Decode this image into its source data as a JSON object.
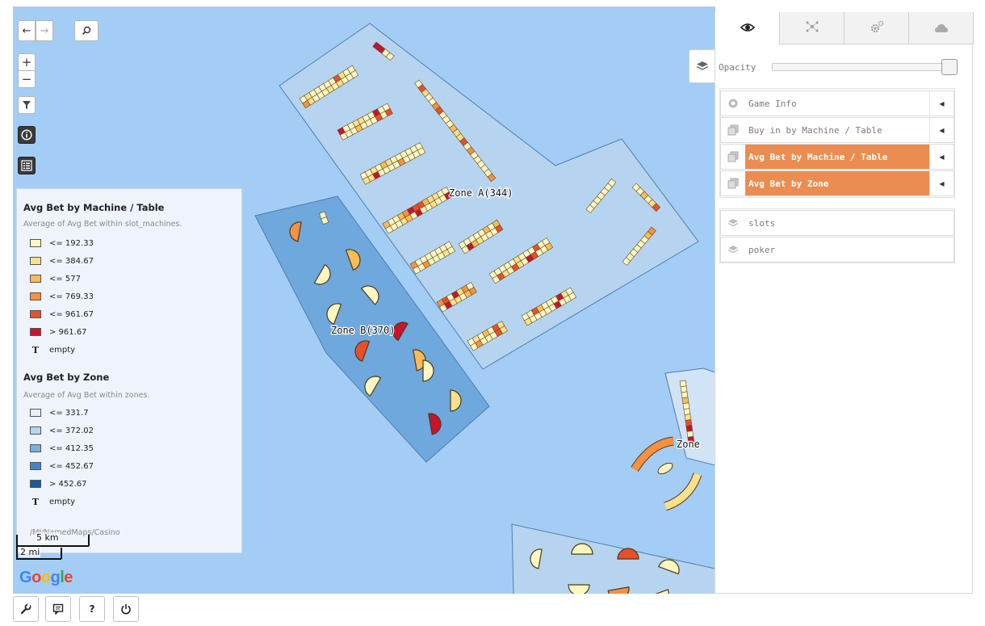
{
  "map": {
    "zones": {
      "zone_a": "Zone A(344)",
      "zone_b": "Zone B(370)",
      "zone_c": "Zone"
    },
    "colors": {
      "water": "#a4cdf6",
      "zone_light": "#b6d4ef",
      "zone_dark": "#6ea8dc",
      "zone_pale": "#d2e3f6",
      "slot1": "#fff6c0",
      "slot2": "#fde08a",
      "slot3": "#fbbb55",
      "slot4": "#f59141",
      "slot5": "#e8502a",
      "slot6": "#c8142c"
    }
  },
  "controls": {
    "back_icon": "arrow-left-icon",
    "forward_icon": "arrow-right-icon",
    "search_icon": "search-icon",
    "zoom_in": "+",
    "zoom_out": "−",
    "filter_icon": "filter-icon",
    "info_icon": "info-icon",
    "list_icon": "list-icon"
  },
  "legend": {
    "section1": {
      "title": "Avg Bet by Machine / Table",
      "subtitle": "Average of Avg Bet within slot_machines.",
      "items": [
        {
          "label": "<= 192.33",
          "color": "#fff6c0"
        },
        {
          "label": "<= 384.67",
          "color": "#fde08a"
        },
        {
          "label": "<= 577",
          "color": "#fbbb55"
        },
        {
          "label": "<= 769.33",
          "color": "#f59141"
        },
        {
          "label": "<= 961.67",
          "color": "#e8502a"
        },
        {
          "label": "> 961.67",
          "color": "#c8142c"
        }
      ],
      "empty_symbol": "T",
      "empty_label": "empty"
    },
    "section2": {
      "title": "Avg Bet by Zone",
      "subtitle": "Average of Avg Bet within zones.",
      "items": [
        {
          "label": "<= 331.7",
          "color": "#e8f1fb"
        },
        {
          "label": "<= 372.02",
          "color": "#b9d5ef"
        },
        {
          "label": "<= 412.35",
          "color": "#79b0e2"
        },
        {
          "label": "<= 452.67",
          "color": "#3f86c8"
        },
        {
          "label": "> 452.67",
          "color": "#1a5a9e"
        }
      ],
      "empty_symbol": "T",
      "empty_label": "empty"
    },
    "path": "/MI/NamedMaps/Casino"
  },
  "scale": {
    "km": "5 km",
    "mi": "2 mi"
  },
  "google": {
    "letters": [
      {
        "ch": "G",
        "color": "#4285f4"
      },
      {
        "ch": "o",
        "color": "#ea4335"
      },
      {
        "ch": "o",
        "color": "#fbbc05"
      },
      {
        "ch": "g",
        "color": "#4285f4"
      },
      {
        "ch": "l",
        "color": "#34a853"
      },
      {
        "ch": "e",
        "color": "#ea4335"
      }
    ]
  },
  "panel": {
    "tabs": [
      {
        "icon": "eye-icon",
        "active": true
      },
      {
        "icon": "network-icon",
        "active": false
      },
      {
        "icon": "gears-icon",
        "active": false
      },
      {
        "icon": "cloud-icon",
        "active": false
      }
    ],
    "opacity_label": "Opacity",
    "opacity_value": 1.0,
    "layers": [
      {
        "name": "Game Info",
        "icon": "pin-icon",
        "highlighted": false
      },
      {
        "name": "Buy in by Machine / Table",
        "icon": "layer-icon",
        "highlighted": false
      },
      {
        "name": "Avg Bet by Machine / Table",
        "icon": "layer-icon",
        "highlighted": true
      },
      {
        "name": "Avg Bet by Zone",
        "icon": "layer-icon",
        "highlighted": true
      }
    ],
    "base_layers": [
      {
        "name": "slots",
        "icon": "stack-icon"
      },
      {
        "name": "poker",
        "icon": "stack-icon"
      }
    ]
  },
  "bottom_bar": {
    "buttons": [
      {
        "icon": "wrench-icon"
      },
      {
        "icon": "comment-icon"
      },
      {
        "icon": "help-icon",
        "label": "?"
      },
      {
        "icon": "power-icon"
      }
    ]
  }
}
